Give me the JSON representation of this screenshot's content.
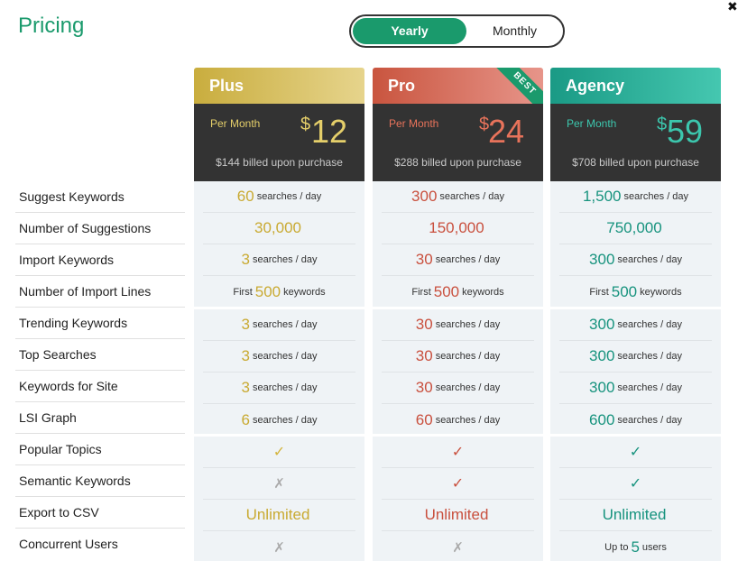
{
  "header": {
    "title": "Pricing",
    "close_label": "✖"
  },
  "billing_toggle": {
    "yearly": "Yearly",
    "monthly": "Monthly",
    "selected": "Yearly"
  },
  "features": [
    "Suggest Keywords",
    "Number of Suggestions",
    "Import Keywords",
    "Number of Import Lines",
    "Trending Keywords",
    "Top Searches",
    "Keywords for Site",
    "LSI Graph",
    "Popular Topics",
    "Semantic Keywords",
    "Export to CSV",
    "Concurrent Users"
  ],
  "per_day": "searches / day",
  "per_month": "Per Month",
  "currency": "$",
  "first_label": "First",
  "keywords_label": "keywords",
  "up_to_label": "Up to",
  "users_label": "users",
  "check": "✓",
  "cross": "✗",
  "plans": {
    "plus": {
      "name": "Plus",
      "price": "12",
      "billed": "$144 billed upon purchase",
      "accent": "#c9aa32",
      "suggest_keywords": "60",
      "number_of_suggestions": "30,000",
      "import_keywords": "3",
      "import_lines": "500",
      "trending_keywords": "3",
      "top_searches": "3",
      "keywords_for_site": "3",
      "lsi_graph": "6",
      "popular_topics": "check",
      "semantic_keywords": "cross",
      "export_csv": "Unlimited",
      "concurrent_users": "cross"
    },
    "pro": {
      "name": "Pro",
      "badge": "BEST",
      "price": "24",
      "billed": "$288 billed upon purchase",
      "accent": "#c9503e",
      "suggest_keywords": "300",
      "number_of_suggestions": "150,000",
      "import_keywords": "30",
      "import_lines": "500",
      "trending_keywords": "30",
      "top_searches": "30",
      "keywords_for_site": "30",
      "lsi_graph": "60",
      "popular_topics": "check",
      "semantic_keywords": "check",
      "export_csv": "Unlimited",
      "concurrent_users": "cross"
    },
    "agency": {
      "name": "Agency",
      "price": "59",
      "billed": "$708 billed upon purchase",
      "accent": "#17937e",
      "suggest_keywords": "1,500",
      "number_of_suggestions": "750,000",
      "import_keywords": "300",
      "import_lines": "500",
      "trending_keywords": "300",
      "top_searches": "300",
      "keywords_for_site": "300",
      "lsi_graph": "600",
      "popular_topics": "check",
      "semantic_keywords": "check",
      "export_csv": "Unlimited",
      "concurrent_users": "5"
    }
  }
}
